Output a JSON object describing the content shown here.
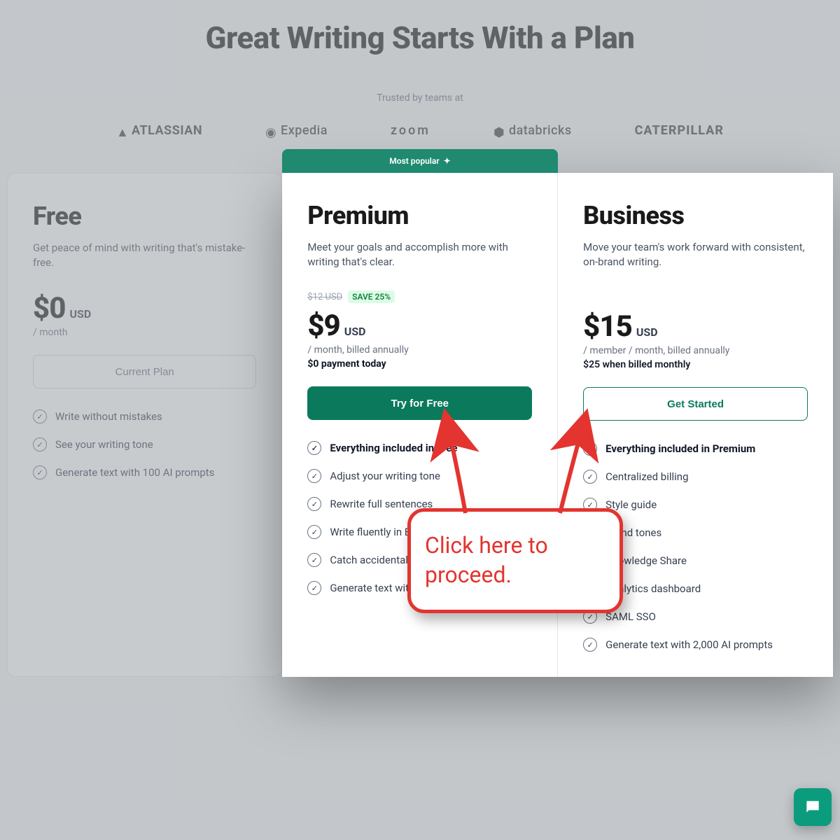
{
  "heading": "Great Writing Starts With a Plan",
  "trusted_label": "Trusted by teams at",
  "logos": [
    "ATLASSIAN",
    "Expedia",
    "zoom",
    "databricks",
    "CATERPILLAR"
  ],
  "popular_badge": "Most popular",
  "plans": {
    "free": {
      "title": "Free",
      "description": "Get peace of mind with writing that's mistake-free.",
      "price": "$0",
      "currency": "USD",
      "billing": "/ month",
      "cta": "Current Plan",
      "features": [
        "Write without mistakes",
        "See your writing tone",
        "Generate text with 100 AI prompts"
      ]
    },
    "premium": {
      "title": "Premium",
      "description": "Meet your goals and accomplish more with writing that's clear.",
      "strike": "$12 USD",
      "save": "SAVE 25%",
      "price": "$9",
      "currency": "USD",
      "billing": "/ month, billed annually",
      "subnote": "$0 payment today",
      "cta": "Try for Free",
      "features_lead": "Everything included in Free",
      "features": [
        "Adjust your writing tone",
        "Rewrite full sentences",
        "Write fluently in English",
        "Catch accidental plagiarism",
        "Generate text with 1,000 AI prompts"
      ]
    },
    "business": {
      "title": "Business",
      "description": "Move your team's work forward with consistent, on-brand writing.",
      "price": "$15",
      "currency": "USD",
      "billing": "/ member / month, billed annually",
      "subnote": "$25 when billed monthly",
      "cta": "Get Started",
      "features_lead": "Everything included in Premium",
      "features": [
        "Centralized billing",
        "Style guide",
        "Brand tones",
        "Knowledge Share",
        "Analytics dashboard",
        "SAML SSO",
        "Generate text with 2,000 AI prompts"
      ]
    }
  },
  "annotation": "Click here to proceed."
}
